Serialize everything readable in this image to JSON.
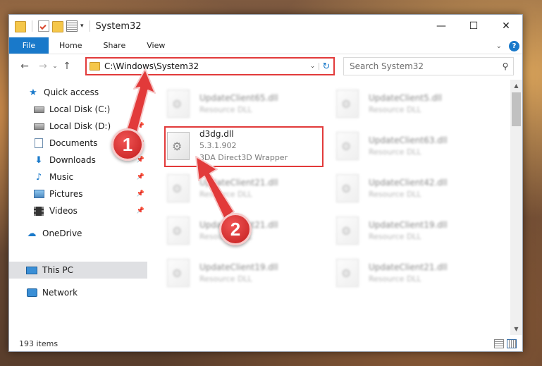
{
  "window": {
    "title": "System32",
    "controls": {
      "minimize": "—",
      "maximize": "☐",
      "close": "✕"
    }
  },
  "ribbon": {
    "tabs": [
      "File",
      "Home",
      "Share",
      "View"
    ],
    "help": "?"
  },
  "address": {
    "path": "C:\\Windows\\System32",
    "search_placeholder": "Search System32"
  },
  "sidebar": {
    "items": [
      {
        "label": "Quick access",
        "icon": "star-icon",
        "pinned": false
      },
      {
        "label": "Local Disk (C:)",
        "icon": "drive-icon",
        "pinned": true
      },
      {
        "label": "Local Disk (D:)",
        "icon": "drive-icon",
        "pinned": true
      },
      {
        "label": "Documents",
        "icon": "documents-icon",
        "pinned": true
      },
      {
        "label": "Downloads",
        "icon": "downloads-icon",
        "pinned": true
      },
      {
        "label": "Music",
        "icon": "music-icon",
        "pinned": true
      },
      {
        "label": "Pictures",
        "icon": "pictures-icon",
        "pinned": true
      },
      {
        "label": "Videos",
        "icon": "videos-icon",
        "pinned": true
      },
      {
        "label": "OneDrive",
        "icon": "onedrive-icon",
        "pinned": false
      },
      {
        "label": "This PC",
        "icon": "this-pc-icon",
        "pinned": false,
        "selected": true
      },
      {
        "label": "Network",
        "icon": "network-icon",
        "pinned": false
      }
    ]
  },
  "files": {
    "left": [
      {
        "name": "UpdateClient65.dll",
        "desc": "Resource DLL",
        "blurred": true
      },
      {
        "name": "d3dg.dll",
        "version": "5.3.1.902",
        "desc": "3DA Direct3D Wrapper",
        "blurred": false,
        "highlighted": true
      },
      {
        "name": "UpdateClient21.dll",
        "desc": "Resource DLL",
        "blurred": true
      },
      {
        "name": "UpdateClient21.dll",
        "desc": "Resource DLL",
        "blurred": true
      },
      {
        "name": "UpdateClient19.dll",
        "desc": "Resource DLL",
        "blurred": true
      }
    ],
    "right": [
      {
        "name": "UpdateClient5.dll",
        "desc": "Resource DLL",
        "blurred": true
      },
      {
        "name": "UpdateClient63.dll",
        "desc": "Resource DLL",
        "blurred": true
      },
      {
        "name": "UpdateClient42.dll",
        "desc": "Resource DLL",
        "blurred": true
      },
      {
        "name": "UpdateClient19.dll",
        "desc": "Resource DLL",
        "blurred": true
      },
      {
        "name": "UpdateClient21.dll",
        "desc": "Resource DLL",
        "blurred": true
      }
    ]
  },
  "status": {
    "item_count": "193 items"
  },
  "annotations": {
    "step1": "1",
    "step2": "2",
    "color": "#e23a3a"
  }
}
